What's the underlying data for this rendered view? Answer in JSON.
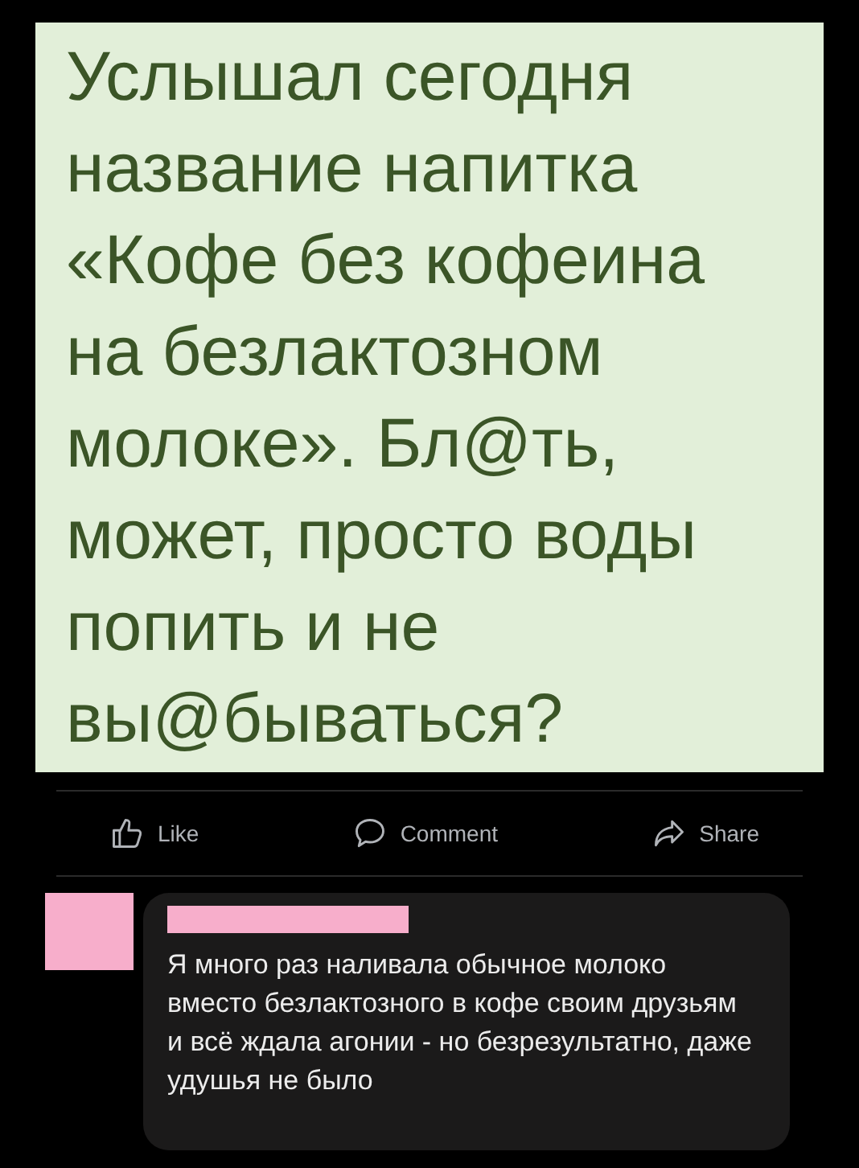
{
  "post_image": {
    "lines": [
      "Услышал сегодня",
      "название напитка",
      "«Кофе без кофеина",
      "на безлактозном",
      "молоке». Бл@ть,",
      "может, просто воды",
      "попить и не",
      "вы@бываться?"
    ]
  },
  "actions": [
    {
      "kind": "like",
      "label": "Like"
    },
    {
      "kind": "comment",
      "label": "Comment"
    },
    {
      "kind": "share",
      "label": "Share"
    }
  ],
  "comment": {
    "avatar_redacted": true,
    "author_redacted": true,
    "text": "Я много раз наливала обычное молоко вместо безлактозного в кофе своим друзьям и всё ждала агонии - но безрезультатно, даже удушья не было"
  }
}
